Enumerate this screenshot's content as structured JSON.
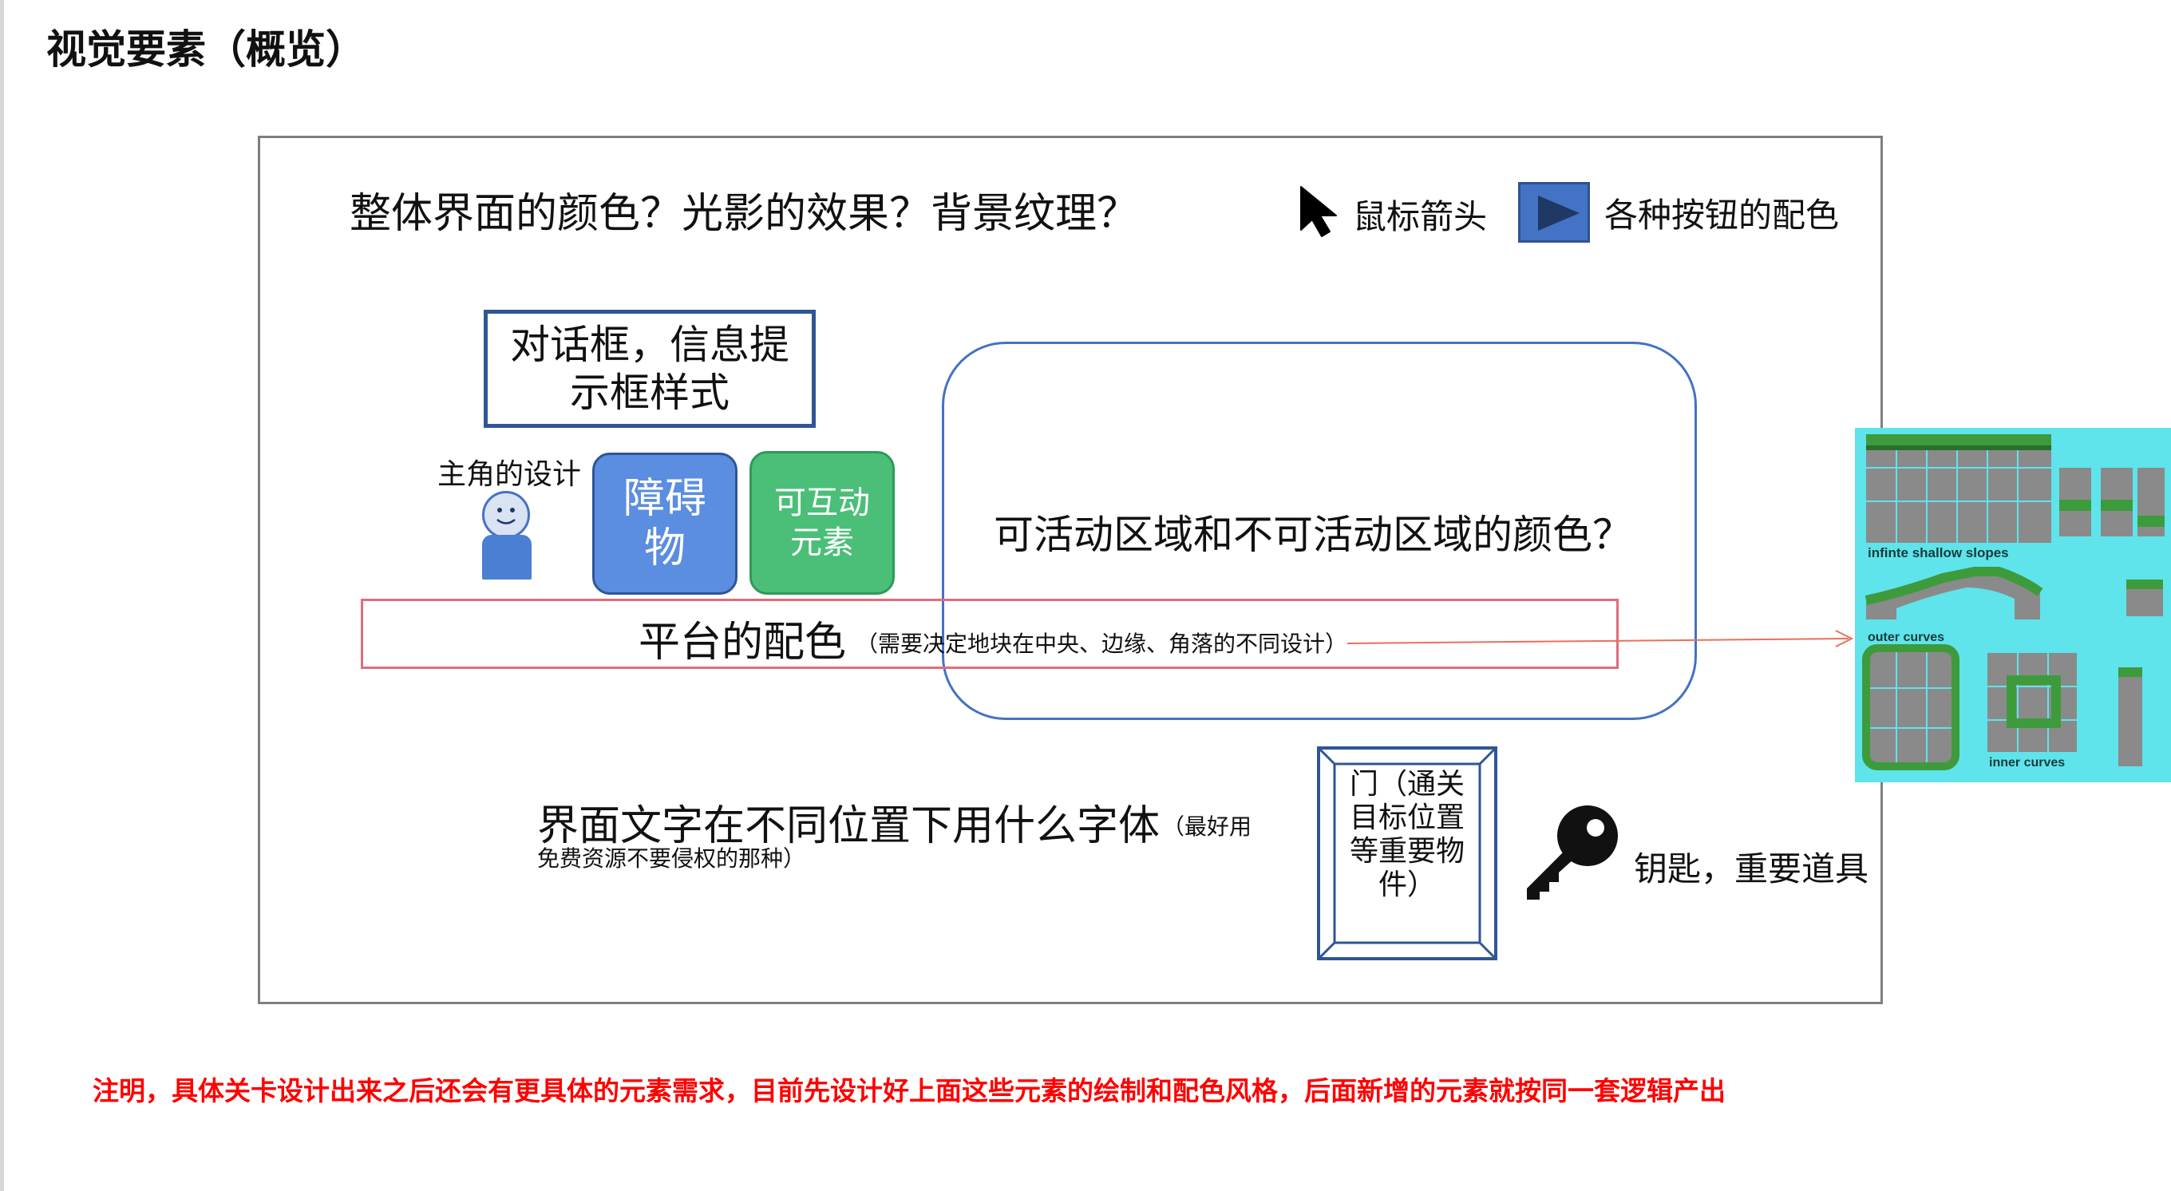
{
  "page": {
    "title": "视觉要素（概览）"
  },
  "panel": {
    "overall_question": "整体界面的颜色？光影的效果？背景纹理？",
    "cursor_label": "鼠标箭头",
    "button_label": "各种按钮的配色",
    "dialog_label": "对话框，信息提示框样式",
    "active_area_label": "可活动区域和不可活动区域的颜色？",
    "hero_label": "主角的设计",
    "obstacle_label": "障碍物",
    "interactive_label": "可互动元素",
    "platform_label": "平台的配色",
    "platform_note": "（需要决定地块在中央、边缘、角落的不同设计）",
    "font_question": "界面文字在不同位置下用什么字体",
    "font_note_1": "（最好用",
    "font_note_2": "免费资源不要侵权的那种）",
    "door_label": "门（通关目标位置等重要物件）",
    "key_label": "钥匙，重要道具"
  },
  "tileset": {
    "captions": {
      "slopes": "infinte shallow slopes",
      "outer": "outer curves",
      "inner": "inner curves"
    }
  },
  "footnote": "注明，具体关卡设计出来之后还会有更具体的元素需求，目前先设计好上面这些元素的绘制和配色风格，后面新增的元素就按同一套逻辑产出",
  "colors": {
    "panel_border": "#7f7f7f",
    "dialog_border": "#2f5597",
    "obstacle_fill": "#5b8de0",
    "interactive_fill": "#4bbf78",
    "platform_border": "#e06c7c",
    "tileset_background": "#5ee4ea",
    "footnote": "#ff0000"
  },
  "icons": [
    "cursor-arrow-icon",
    "play-button-icon",
    "smiley-figure-icon",
    "door-frame-icon",
    "key-icon",
    "arrow-right-icon"
  ]
}
